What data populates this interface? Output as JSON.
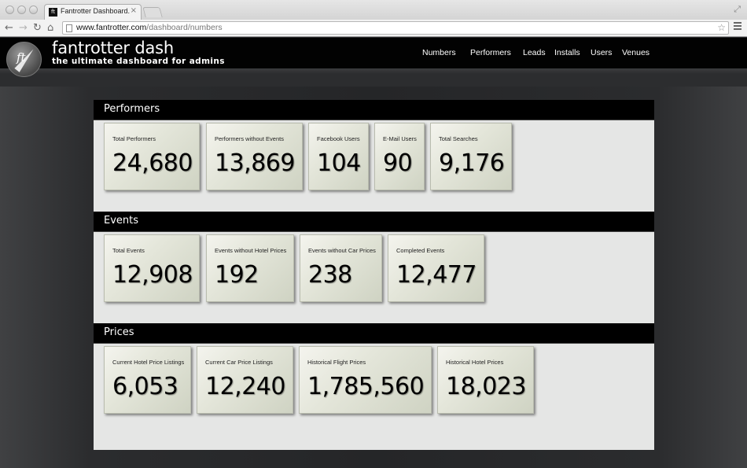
{
  "browser": {
    "tab_title": "Fantrotter Dashboard.",
    "tab_favicon_text": "ft",
    "tab_close": "×",
    "url_host": "www.fantrotter.com",
    "url_path": "/dashboard/numbers",
    "back_icon": "←",
    "forward_icon": "→",
    "reload_icon": "↻",
    "home_icon": "⌂",
    "star_icon": "☆",
    "fullscreen_icon": "⤢"
  },
  "site": {
    "logo_text": "ft",
    "title": "fantrotter dash",
    "tagline": "the ultimate dashboard for admins",
    "nav": [
      "Numbers",
      "Performers",
      "Leads",
      "Installs",
      "Users",
      "Venues"
    ]
  },
  "sections": [
    {
      "title": "Performers",
      "cards": [
        {
          "label": "Total Performers",
          "value": "24,680"
        },
        {
          "label": "Performers without Events",
          "value": "13,869"
        },
        {
          "label": "Facebook Users",
          "value": "104"
        },
        {
          "label": "E-Mail Users",
          "value": "90"
        },
        {
          "label": "Total Searches",
          "value": "9,176"
        }
      ]
    },
    {
      "title": "Events",
      "cards": [
        {
          "label": "Total Events",
          "value": "12,908"
        },
        {
          "label": "Events without Hotel Prices",
          "value": "192"
        },
        {
          "label": "Events without Car Prices",
          "value": "238"
        },
        {
          "label": "Completed Events",
          "value": "12,477"
        }
      ]
    },
    {
      "title": "Prices",
      "cards": [
        {
          "label": "Current Hotel Price Listings",
          "value": "6,053"
        },
        {
          "label": "Current Car Price Listings",
          "value": "12,240"
        },
        {
          "label": "Historical Flight Prices",
          "value": "1,785,560"
        },
        {
          "label": "Historical Hotel Prices",
          "value": "18,023"
        }
      ]
    }
  ]
}
